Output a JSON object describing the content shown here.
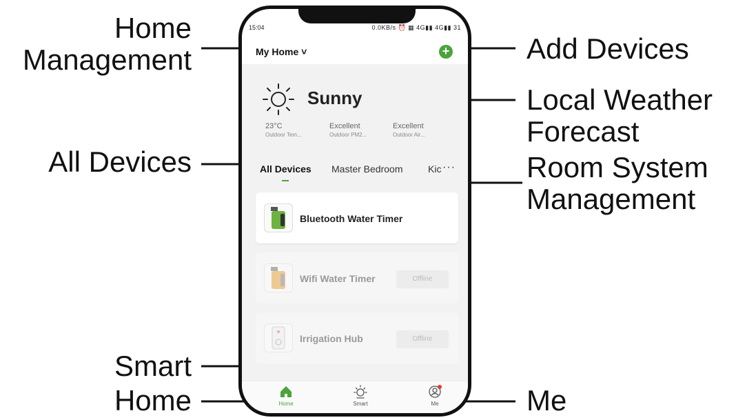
{
  "callouts": {
    "home_management": [
      "Home",
      "Management"
    ],
    "add_devices": "Add Devices",
    "local_weather": [
      "Local Weather",
      "Forecast"
    ],
    "all_devices": "All Devices",
    "room_system": [
      "Room System",
      "Management"
    ],
    "smart": "Smart",
    "home": "Home",
    "me": "Me"
  },
  "status_bar": {
    "time": "15:04",
    "right": "0.0KB/s ⏰ ▦ 4G▮▮ 4G▮▮ 31"
  },
  "header": {
    "home_title": "My Home ˅",
    "add_icon": "plus-circle-icon"
  },
  "weather": {
    "condition": "Sunny",
    "icon": "sun-icon",
    "stats": [
      {
        "value": "23°C",
        "label": "Outdoor Tem..."
      },
      {
        "value": "Excellent",
        "label": "Outdoor PM2..."
      },
      {
        "value": "Excellent",
        "label": "Outdoor Air..."
      }
    ]
  },
  "tabs": [
    "All Devices",
    "Master Bedroom",
    "Kic"
  ],
  "more": "···",
  "devices": [
    {
      "name": "Bluetooth Water Timer",
      "status": ""
    },
    {
      "name": "Wifi Water Timer",
      "status": "Offline"
    },
    {
      "name": "Irrigation Hub",
      "status": "Offline"
    }
  ],
  "tabbar": [
    {
      "label": "Home",
      "icon": "home-icon"
    },
    {
      "label": "Smart",
      "icon": "smart-sun-icon"
    },
    {
      "label": "Me",
      "icon": "profile-icon"
    }
  ],
  "colors": {
    "accent": "#4aa43a",
    "badge": "#e53935"
  }
}
